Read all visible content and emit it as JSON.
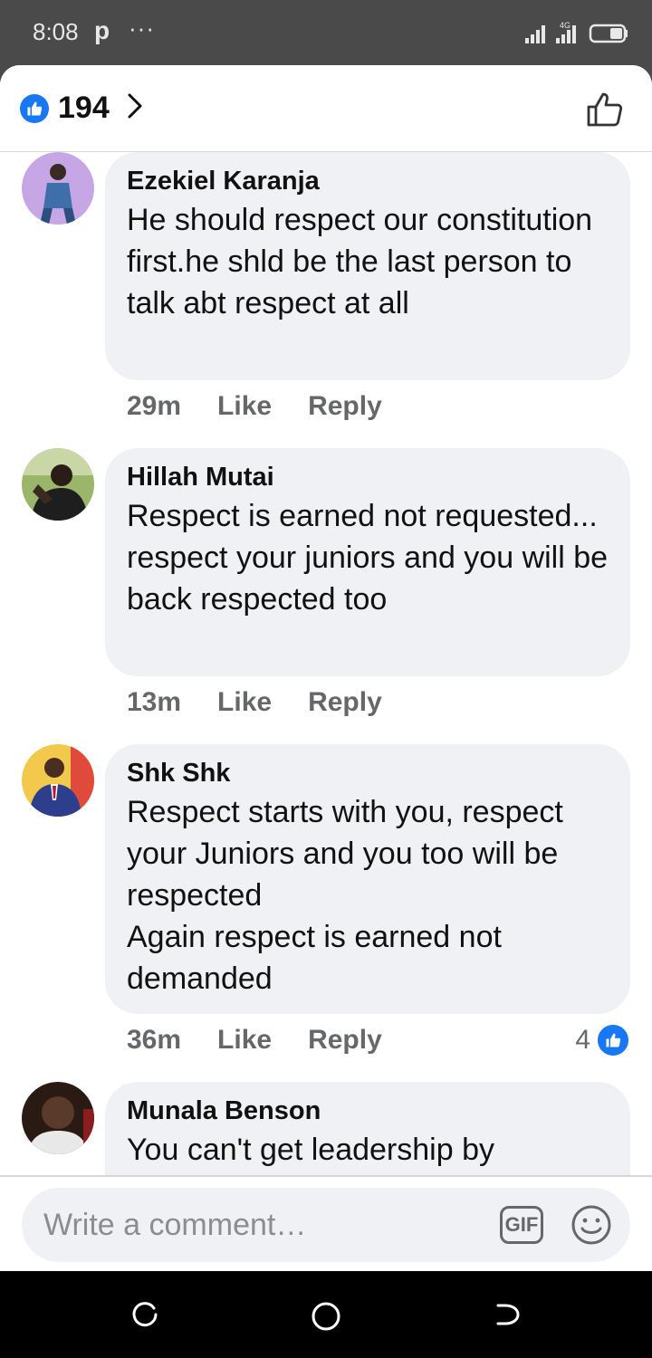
{
  "status_bar": {
    "time": "8:08",
    "notification_icon": "p",
    "more": "···",
    "network_label": "4G",
    "icons": [
      "signal-icon",
      "signal-4g-icon",
      "battery-icon"
    ]
  },
  "header": {
    "likes_count": "194",
    "icons": [
      "like-badge-icon",
      "chevron-right-icon",
      "thumbs-up-outline-icon"
    ]
  },
  "comments": [
    {
      "author": "Ezekiel Karanja",
      "text": "He should respect our constitution first.he shld be the last person to talk abt respect at all",
      "time": "29m",
      "like_label": "Like",
      "reply_label": "Reply",
      "reactions": null
    },
    {
      "author": "Hillah Mutai",
      "text": "Respect is earned not requested... respect your juniors and you will be back respected too",
      "time": "13m",
      "like_label": "Like",
      "reply_label": "Reply",
      "reactions": null
    },
    {
      "author": "Shk Shk",
      "text": "Respect starts with you, respect your Juniors and you too will be respected\nAgain respect is earned not demanded",
      "time": "36m",
      "like_label": "Like",
      "reply_label": "Reply",
      "reactions": "4"
    },
    {
      "author": "Munala Benson",
      "text": "You can't get leadership by",
      "time": "",
      "like_label": "",
      "reply_label": "",
      "reactions": null
    }
  ],
  "composer": {
    "placeholder": "Write a comment…",
    "gif_label": "GIF",
    "icons": [
      "gif-icon",
      "emoji-icon"
    ]
  },
  "nav_bar": {
    "icons": [
      "recent-apps-icon",
      "home-icon",
      "back-icon"
    ]
  },
  "colors": {
    "brand_blue": "#1877f2",
    "bubble_bg": "#f0f1f5",
    "meta_gray": "#65676b",
    "status_bar_bg": "#4a4a4a"
  }
}
